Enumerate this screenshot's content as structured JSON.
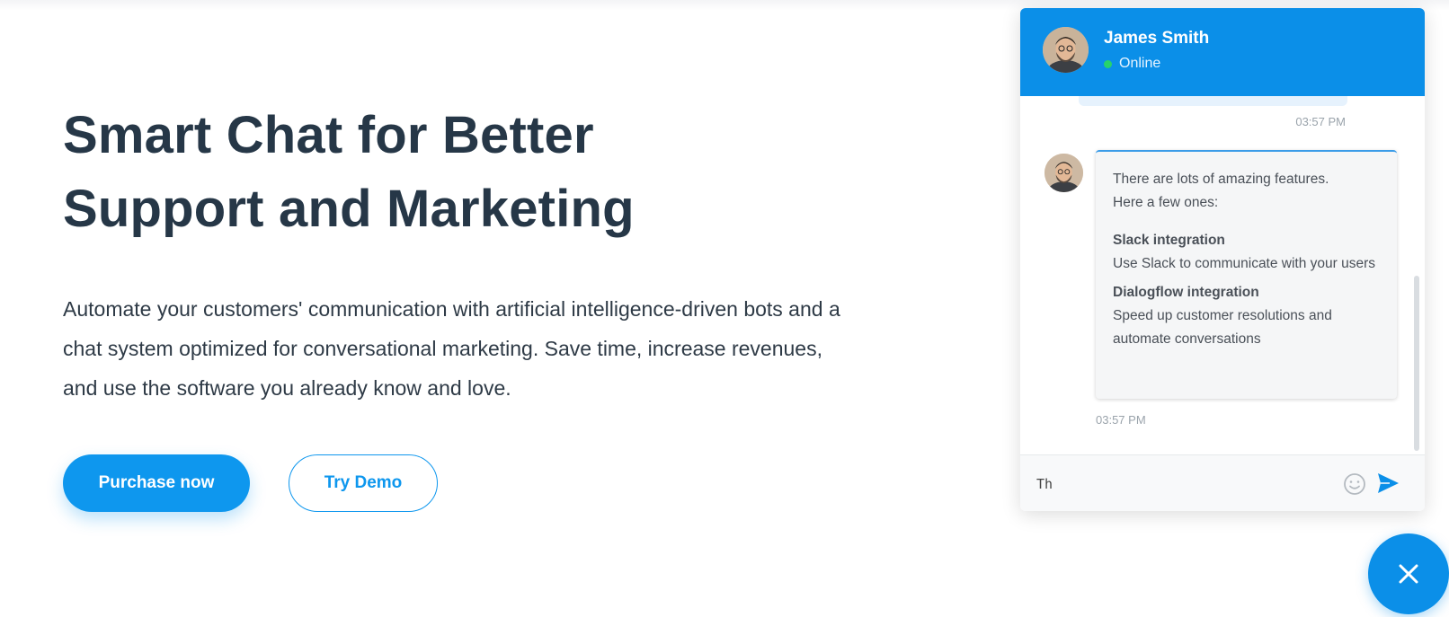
{
  "hero": {
    "title_line1": "Smart Chat for Better",
    "title_line2": "Support and Marketing",
    "description": "Automate your customers' communication with artificial intelligence-driven bots and a chat system optimized for conversational marketing. Save time, increase revenues, and use the software you already know and love.",
    "primary_button": "Purchase now",
    "secondary_button": "Try Demo"
  },
  "chat": {
    "agent_name": "James Smith",
    "status": "Online",
    "previous_time": "03:57 PM",
    "message": {
      "intro_line1": "There are lots of amazing features.",
      "intro_line2": "Here a few ones:",
      "features": [
        {
          "title": "Slack integration",
          "text": "Use Slack to communicate with your users"
        },
        {
          "title": "Dialogflow integration",
          "text": "Speed up customer resolutions and automate conversations"
        }
      ],
      "time": "03:57 PM"
    },
    "input_value": "Th"
  },
  "icons": {
    "avatar": "agent-avatar",
    "status": "online-dot-icon",
    "emoji": "emoji-icon",
    "send": "send-icon",
    "close": "close-icon"
  },
  "colors": {
    "accent": "#0e97ee",
    "header": "#0b8fe8",
    "heading": "#263747",
    "online": "#27d36b"
  }
}
